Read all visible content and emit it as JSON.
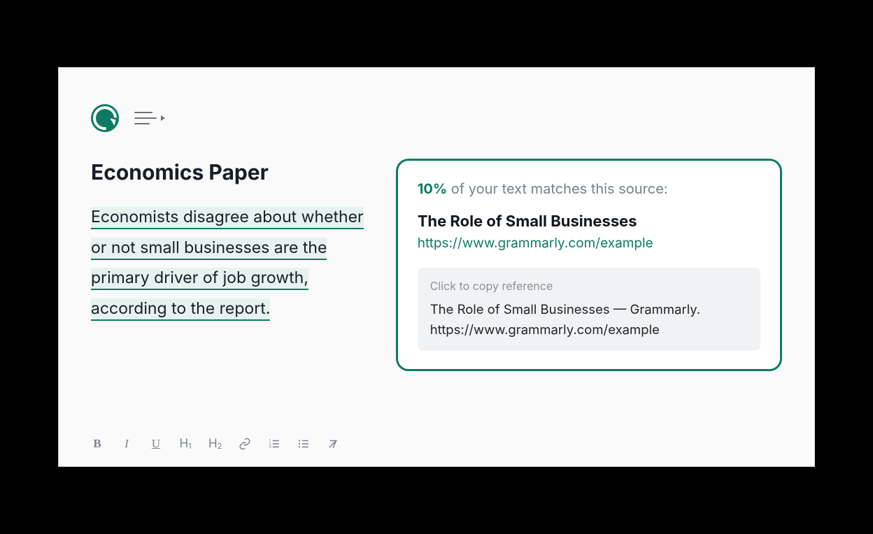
{
  "document": {
    "title": "Economics Paper",
    "highlighted_body": "Economists disagree about whether or not small businesses are the primary driver of job growth, according to the report."
  },
  "plagiarism_card": {
    "percent": "10%",
    "headline_rest": " of your text matches this source:",
    "source_title": "The Role of Small Businesses",
    "source_url": "https://www.grammarly.com/example",
    "copy_label": "Click to copy reference",
    "copy_text": "The Role of Small Businesses — Grammarly. https://www.grammarly.com/example"
  },
  "toolbar": {
    "bold": "B",
    "italic": "I",
    "underline": "U",
    "h1": "H",
    "h1_sub": "1",
    "h2": "H",
    "h2_sub": "2"
  }
}
